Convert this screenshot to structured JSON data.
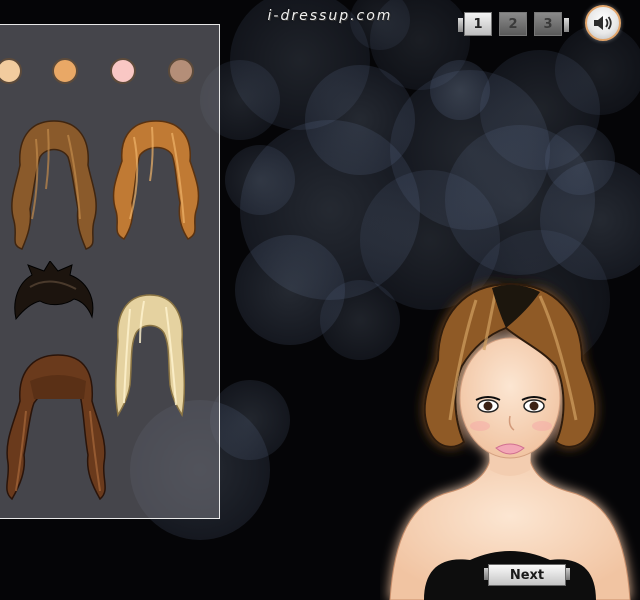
{
  "header": {
    "site_logo": "i-dressup.com"
  },
  "page_nav": {
    "pages": [
      {
        "label": "1",
        "active": true
      },
      {
        "label": "2",
        "active": false
      },
      {
        "label": "3",
        "active": false
      }
    ]
  },
  "sound": {
    "icon": "speaker-icon"
  },
  "panel": {
    "skin_swatches": [
      {
        "color": "#f2cc9e"
      },
      {
        "color": "#e9a866"
      },
      {
        "color": "#f9c7c4"
      },
      {
        "color": "#b48e78"
      }
    ],
    "hairstyles": [
      {
        "name": "long-wavy-brown",
        "color": "#8a5a2b"
      },
      {
        "name": "long-wavy-copper",
        "color": "#c07a34"
      },
      {
        "name": "short-spiky-black",
        "color": "#1c140e"
      },
      {
        "name": "long-straight-blonde",
        "color": "#e5d2a0"
      },
      {
        "name": "long-wavy-chestnut-bangs",
        "color": "#6a3a1c"
      }
    ]
  },
  "model": {
    "hair_color": "#8f5a28",
    "lip_color": "#f3a7b6",
    "top_color": "#0c0c0c"
  },
  "footer": {
    "next_label": "Next"
  }
}
